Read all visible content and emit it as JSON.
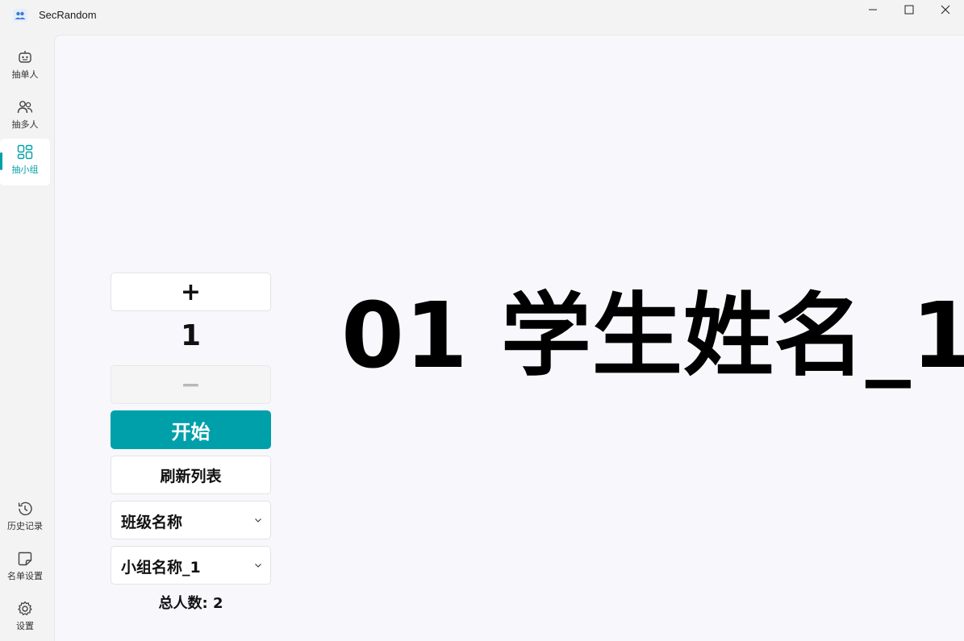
{
  "window": {
    "title": "SecRandom"
  },
  "sidebar": {
    "top_items": [
      {
        "label": "抽单人",
        "icon": "robot-icon"
      },
      {
        "label": "抽多人",
        "icon": "people-icon"
      },
      {
        "label": "抽小组",
        "icon": "grid-icon"
      }
    ],
    "bottom_items": [
      {
        "label": "历史记录",
        "icon": "history-icon"
      },
      {
        "label": "名单设置",
        "icon": "sticky-note-icon"
      },
      {
        "label": "设置",
        "icon": "gear-icon"
      }
    ],
    "active": "抽小组"
  },
  "controls": {
    "plus_label": "+",
    "count": "1",
    "minus_label": "−",
    "start_label": "开始",
    "refresh_label": "刷新列表",
    "class_select": "班级名称",
    "group_select": "小组名称_1",
    "total_text": "总人数: 2"
  },
  "result": {
    "text": "01 学生姓名_1"
  },
  "colors": {
    "accent": "#00a0ab",
    "content_bg": "#f8f7fb",
    "chrome_bg": "#f3f3f3"
  }
}
